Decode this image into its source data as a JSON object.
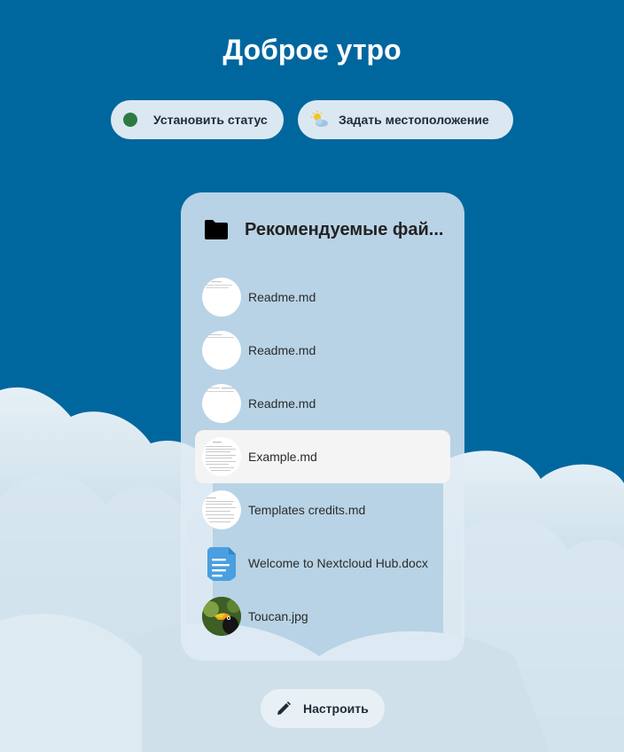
{
  "greeting": "Доброе утро",
  "status_actions": {
    "set_status": {
      "label": "Установить статус",
      "status_color": "#2d7b41"
    },
    "set_location": {
      "label": "Задать местоположение",
      "icon": "weather-partly-sunny-icon"
    }
  },
  "recommended": {
    "title": "Рекомендуемые фай...",
    "icon": "folder-icon",
    "files": [
      {
        "name": "Readme.md",
        "thumb": "document-preview"
      },
      {
        "name": "Readme.md",
        "thumb": "document-preview"
      },
      {
        "name": "Readme.md",
        "thumb": "document-preview"
      },
      {
        "name": "Example.md",
        "thumb": "document-preview",
        "selected": true
      },
      {
        "name": "Templates credits.md",
        "thumb": "document-preview"
      },
      {
        "name": "Welcome to Nextcloud Hub.docx",
        "thumb": "docx-icon"
      },
      {
        "name": "Toucan.jpg",
        "thumb": "image-preview"
      }
    ]
  },
  "customize": {
    "label": "Настроить",
    "icon": "pencil-icon"
  },
  "colors": {
    "background": "#00679e",
    "accent_docx": "#4a9fe0"
  }
}
